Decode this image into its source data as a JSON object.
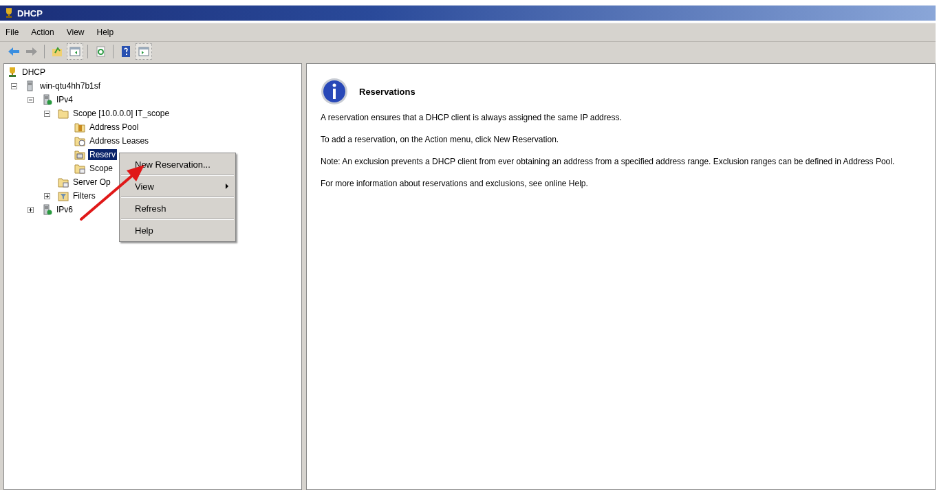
{
  "window": {
    "title": "DHCP"
  },
  "menu_bar": [
    "File",
    "Action",
    "View",
    "Help"
  ],
  "toolbar": [
    {
      "kind": "back",
      "disabled": false
    },
    {
      "kind": "forward",
      "disabled": true
    },
    {
      "kind": "sep"
    },
    {
      "kind": "up"
    },
    {
      "kind": "pane",
      "pressed": true
    },
    {
      "kind": "sep"
    },
    {
      "kind": "refresh"
    },
    {
      "kind": "sep"
    },
    {
      "kind": "help"
    },
    {
      "kind": "pane2",
      "pressed": true
    }
  ],
  "tree": [
    {
      "label": "DHCP",
      "kind": "root",
      "selected": false,
      "children": [
        {
          "label": "win-qtu4hh7b1sf",
          "kind": "server",
          "expanded": true,
          "selected": false,
          "children": [
            {
              "label": "IPv4",
              "kind": "protocol",
              "expanded": true,
              "selected": false,
              "children": [
                {
                  "label": "Scope [10.0.0.0] IT_scope",
                  "kind": "folder",
                  "expanded": true,
                  "selected": false,
                  "children": [
                    {
                      "label": "Address Pool",
                      "kind": "pool",
                      "selected": false
                    },
                    {
                      "label": "Address Leases",
                      "kind": "leases",
                      "selected": false
                    },
                    {
                      "label": "Reserv",
                      "kind": "reservations",
                      "selected": true
                    },
                    {
                      "label": "Scope",
                      "kind": "options",
                      "selected": false
                    }
                  ]
                },
                {
                  "label": "Server Op",
                  "kind": "options",
                  "selected": false
                },
                {
                  "label": "Filters",
                  "kind": "filter",
                  "expanded": false,
                  "selected": false
                }
              ]
            },
            {
              "label": "IPv6",
              "kind": "protocol",
              "expanded": false,
              "selected": false
            }
          ]
        }
      ]
    }
  ],
  "context_menu": [
    {
      "label": "New Reservation...",
      "submenu": false
    },
    {
      "label": "View",
      "submenu": true
    },
    {
      "label": "Refresh",
      "submenu": false
    },
    {
      "label": "Help",
      "submenu": false
    }
  ],
  "details": {
    "heading": "Reservations",
    "paragraphs": [
      "A reservation ensures that a DHCP client is always assigned the same IP address.",
      "To add a reservation, on the Action menu, click New Reservation.",
      "Note: An exclusion prevents a DHCP client from ever obtaining an address from a specified address range.  Exclusion ranges can be defined in Address Pool.",
      "For more information about reservations and exclusions, see online Help."
    ]
  }
}
